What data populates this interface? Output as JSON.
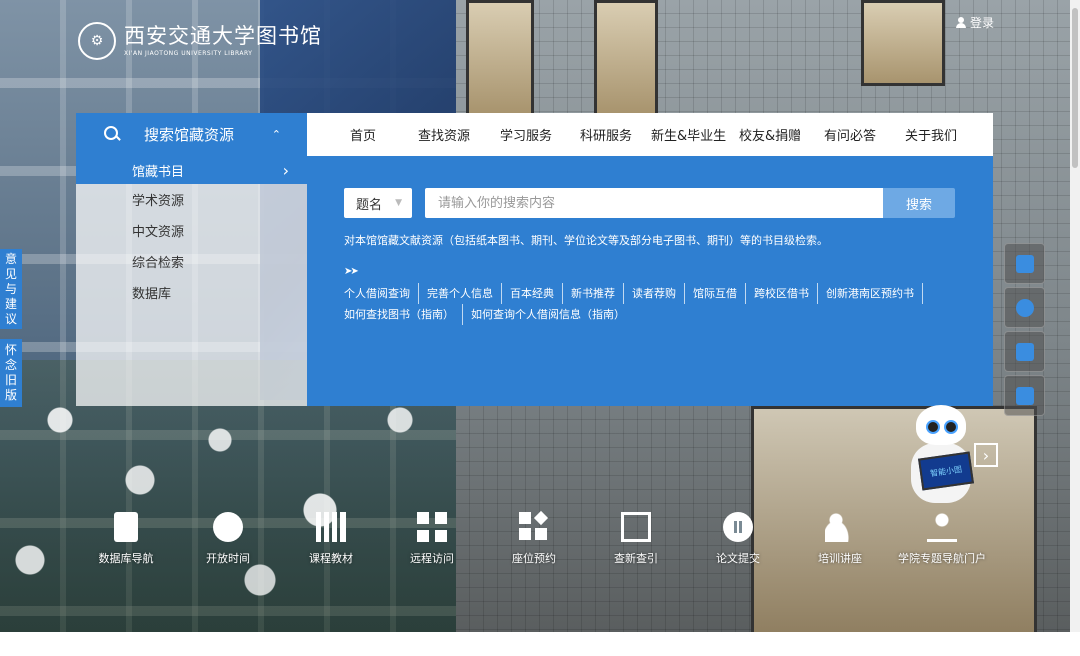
{
  "logo": {
    "name": "西安交通大学图书馆",
    "subtitle": "XI'AN JIAOTONG UNIVERSITY LIBRARY"
  },
  "header": {
    "login": "登录"
  },
  "search_panel": {
    "title": "搜索馆藏资源",
    "items": [
      {
        "label": "馆藏书目",
        "active": true
      },
      {
        "label": "学术资源"
      },
      {
        "label": "中文资源"
      },
      {
        "label": "综合检索"
      },
      {
        "label": "数据库"
      }
    ]
  },
  "nav": {
    "items": [
      "首页",
      "查找资源",
      "学习服务",
      "科研服务",
      "新生&毕业生",
      "校友&捐赠",
      "有问必答",
      "关于我们"
    ]
  },
  "search": {
    "field_selected": "题名",
    "placeholder": "请输入你的搜索内容",
    "button": "搜索",
    "description": "对本馆馆藏文献资源（包括纸本图书、期刊、学位论文等及部分电子图书、期刊）等的书目级检索。",
    "arrows": "➤➤",
    "links": [
      "个人借阅查询",
      "完善个人信息",
      "百本经典",
      "新书推荐",
      "读者荐购",
      "馆际互借",
      "跨校区借书",
      "创新港南区预约书",
      "如何查找图书（指南）",
      "如何查询个人借阅信息（指南）"
    ]
  },
  "side_tabs": {
    "feedback": [
      "意",
      "见",
      "与",
      "建",
      "议"
    ],
    "old_version": [
      "怀",
      "念",
      "旧",
      "版"
    ]
  },
  "robot": {
    "screen_text": "智能小图"
  },
  "quick_links": [
    {
      "label": "数据库导航",
      "icon": "document-icon"
    },
    {
      "label": "开放时间",
      "icon": "clock-icon"
    },
    {
      "label": "课程教材",
      "icon": "bar-chart-icon"
    },
    {
      "label": "远程访问",
      "icon": "qr-icon"
    },
    {
      "label": "座位预约",
      "icon": "grid-icon"
    },
    {
      "label": "查新查引",
      "icon": "image-icon"
    },
    {
      "label": "论文提交",
      "icon": "pause-icon"
    },
    {
      "label": "培训讲座",
      "icon": "people-icon"
    },
    {
      "label": "学院专题导航门户",
      "icon": "microscope-icon"
    }
  ],
  "colors": {
    "primary": "#2f7fd1",
    "search_button": "#6ea9e4"
  }
}
